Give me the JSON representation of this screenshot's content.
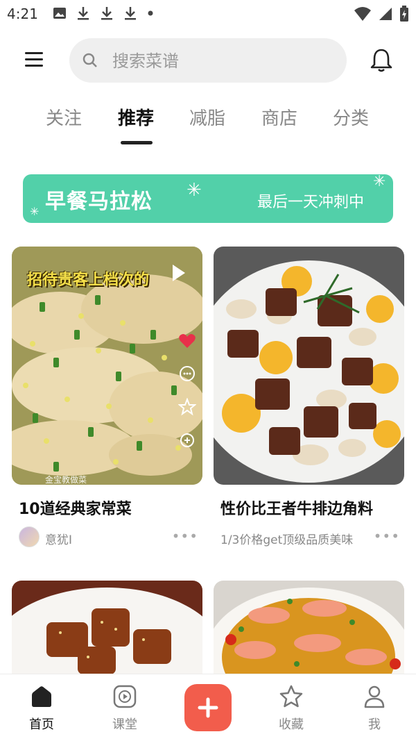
{
  "status_bar": {
    "time": "4:21"
  },
  "search": {
    "placeholder": "搜索菜谱"
  },
  "tabs": [
    {
      "label": "关注",
      "active": false
    },
    {
      "label": "推荐",
      "active": true
    },
    {
      "label": "减脂",
      "active": false
    },
    {
      "label": "商店",
      "active": false
    },
    {
      "label": "分类",
      "active": false
    }
  ],
  "banner": {
    "title": "早餐马拉松",
    "subtitle": "最后一天冲刺中",
    "color": "#52d0a9"
  },
  "cards": [
    {
      "title": "10道经典家常菜",
      "author": "意犹I",
      "overlay_text": "招待贵客上档次的",
      "caption": "金宝教做菜"
    },
    {
      "title": "性价比王者牛排边角料",
      "subtitle": "1/3价格get顶级品质美味"
    },
    {
      "title": ""
    },
    {
      "title": ""
    }
  ],
  "bottom_nav": [
    {
      "label": "首页",
      "icon": "home-icon",
      "active": true
    },
    {
      "label": "课堂",
      "icon": "play-icon",
      "active": false
    },
    {
      "label": "",
      "icon": "plus-icon",
      "active": false
    },
    {
      "label": "收藏",
      "icon": "star-icon",
      "active": false
    },
    {
      "label": "我",
      "icon": "user-icon",
      "active": false
    }
  ],
  "colors": {
    "accent": "#f25d4c",
    "banner": "#52d0a9"
  }
}
